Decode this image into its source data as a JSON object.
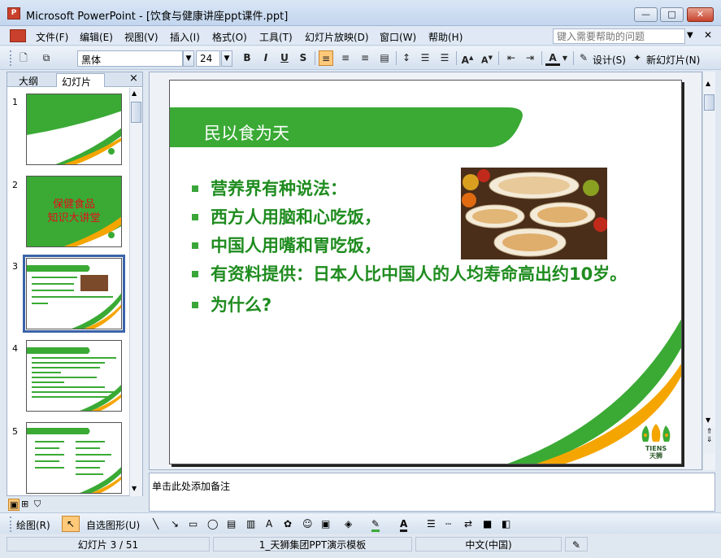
{
  "window": {
    "title": "Microsoft PowerPoint - [饮食与健康讲座ppt课件.ppt]",
    "app_icon": "P",
    "min_label": "—",
    "max_label": "□",
    "close_label": "✕"
  },
  "menubar": {
    "items": [
      "文件(F)",
      "编辑(E)",
      "视图(V)",
      "插入(I)",
      "格式(O)",
      "工具(T)",
      "幻灯片放映(D)",
      "窗口(W)",
      "帮助(H)"
    ],
    "help_placeholder": "键入需要帮助的问题"
  },
  "toolbar": {
    "font_name": "黑体",
    "font_size": "24",
    "bold": "B",
    "italic": "I",
    "underline": "U",
    "shadow": "S",
    "design_label": "设计(S)",
    "new_slide_label": "新幻灯片(N)"
  },
  "left_pane": {
    "tab_outline": "大纲",
    "tab_slides": "幻灯片",
    "close_label": "×",
    "slide_numbers": [
      "1",
      "2",
      "3",
      "4",
      "5"
    ],
    "slide2_title_line1": "保健食品",
    "slide2_title_line2": "知识大讲堂"
  },
  "slide": {
    "title": "民以食为天",
    "bullets": [
      "营养界有种说法：",
      "西方人用脑和心吃饭，",
      "中国人用嘴和胃吃饭，",
      "有资料提供：日本人比中国人的人均寿命高出约10岁。",
      "为什么?"
    ],
    "logo_text_en": "TIENS",
    "logo_text_cn": "天狮",
    "colors": {
      "green": "#3aaa35",
      "text_green": "#1f8c1f",
      "orange": "#f5a500"
    }
  },
  "notes": {
    "placeholder": "单击此处添加备注"
  },
  "drawbar": {
    "draw_label": "绘图(R)",
    "autoshapes_label": "自选图形(U)"
  },
  "status": {
    "slide_position": "幻灯片 3 / 51",
    "template": "1_天狮集团PPT演示模板",
    "language": "中文(中国)"
  }
}
